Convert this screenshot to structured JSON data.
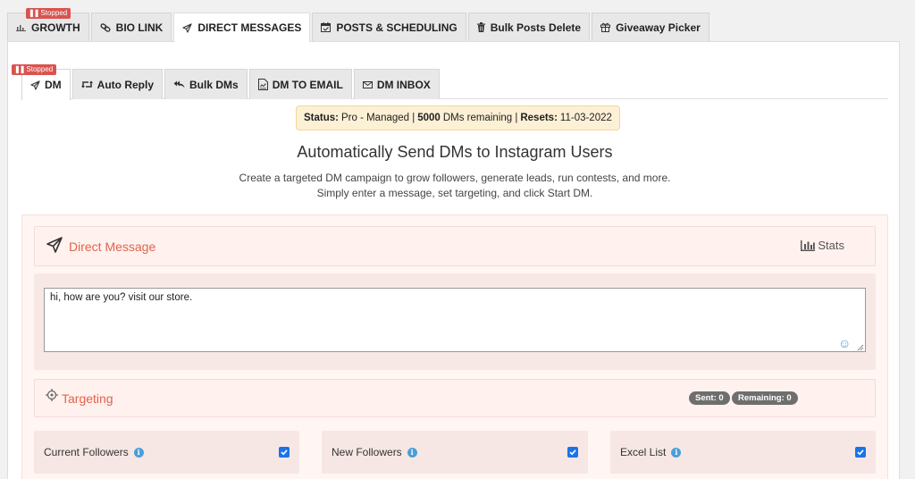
{
  "top_tabs": [
    {
      "label": "GROWTH",
      "icon": "bar-chart-icon",
      "badge": "Stopped"
    },
    {
      "label": "BIO LINK",
      "icon": "link-icon"
    },
    {
      "label": "DIRECT MESSAGES",
      "icon": "paper-plane-icon",
      "active": true
    },
    {
      "label": "POSTS & SCHEDULING",
      "icon": "calendar-icon"
    },
    {
      "label": "Bulk Posts Delete",
      "icon": "trash-icon"
    },
    {
      "label": "Giveaway Picker",
      "icon": "gift-icon"
    }
  ],
  "sub_tabs": [
    {
      "label": "DM",
      "icon": "paper-plane-icon",
      "badge": "Stopped",
      "active": true
    },
    {
      "label": "Auto Reply",
      "icon": "retweet-icon"
    },
    {
      "label": "Bulk DMs",
      "icon": "reply-all-icon"
    },
    {
      "label": "DM TO EMAIL",
      "icon": "document-icon"
    },
    {
      "label": "DM INBOX",
      "icon": "envelope-icon"
    }
  ],
  "status": {
    "label": "Status:",
    "plan": "Pro - Managed |",
    "dms_count": "5000",
    "dms_text": "DMs remaining |",
    "resets_label": "Resets:",
    "resets_date": "11-03-2022"
  },
  "heading": "Automatically Send DMs to Instagram Users",
  "description": {
    "line1": "Create a targeted DM campaign to grow followers, generate leads, run contests, and more.",
    "line2": "Simply enter a message, set targeting, and click Start DM."
  },
  "direct_message": {
    "title": "Direct Message",
    "stats_label": "Stats",
    "message_value": "hi, how are you? visit our store."
  },
  "targeting": {
    "title": "Targeting",
    "sent": "Sent: 0",
    "remaining": "Remaining: 0"
  },
  "options": [
    {
      "label": "Current Followers",
      "checked": true
    },
    {
      "label": "New Followers",
      "checked": true
    },
    {
      "label": "Excel List",
      "checked": true
    }
  ],
  "colors": {
    "accent": "#e0644a",
    "badge": "#d9534f",
    "checkbox": "#1a73e8",
    "info": "#4a9fd8"
  }
}
